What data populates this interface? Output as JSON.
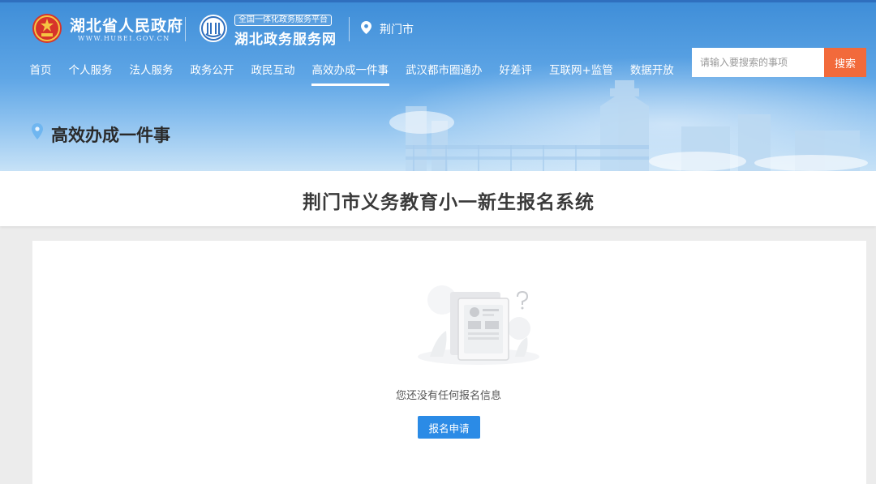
{
  "header": {
    "gov_name": "湖北省人民政府",
    "gov_url": "WWW.HUBEI.GOV.CN",
    "platform_badge": "全国一体化政务服务平台",
    "platform_name": "湖北政务服务网",
    "location": "荆门市"
  },
  "nav": {
    "items": [
      {
        "label": "首页"
      },
      {
        "label": "个人服务"
      },
      {
        "label": "法人服务"
      },
      {
        "label": "政务公开"
      },
      {
        "label": "政民互动"
      },
      {
        "label": "高效办成一件事",
        "active": true
      },
      {
        "label": "武汉都市圈通办"
      },
      {
        "label": "好差评"
      },
      {
        "label": "互联网+监管"
      },
      {
        "label": "数据开放"
      }
    ]
  },
  "search": {
    "placeholder": "请输入要搜索的事项",
    "button_label": "搜索"
  },
  "page": {
    "title": "高效办成一件事"
  },
  "system": {
    "title": "荆门市义务教育小一新生报名系统"
  },
  "empty_state": {
    "message": "您还没有任何报名信息",
    "button_label": "报名申请"
  },
  "colors": {
    "header_blue": "#3f8ed8",
    "search_button": "#f26a3b",
    "primary_button": "#2b8be6",
    "page_background": "#ececec"
  },
  "icons": {
    "government_emblem": "gov-emblem-icon",
    "platform_logo": "platform-logo-icon",
    "location": "location-pin-icon",
    "title_pin": "map-pin-icon",
    "empty_state": "empty-document-icon"
  }
}
